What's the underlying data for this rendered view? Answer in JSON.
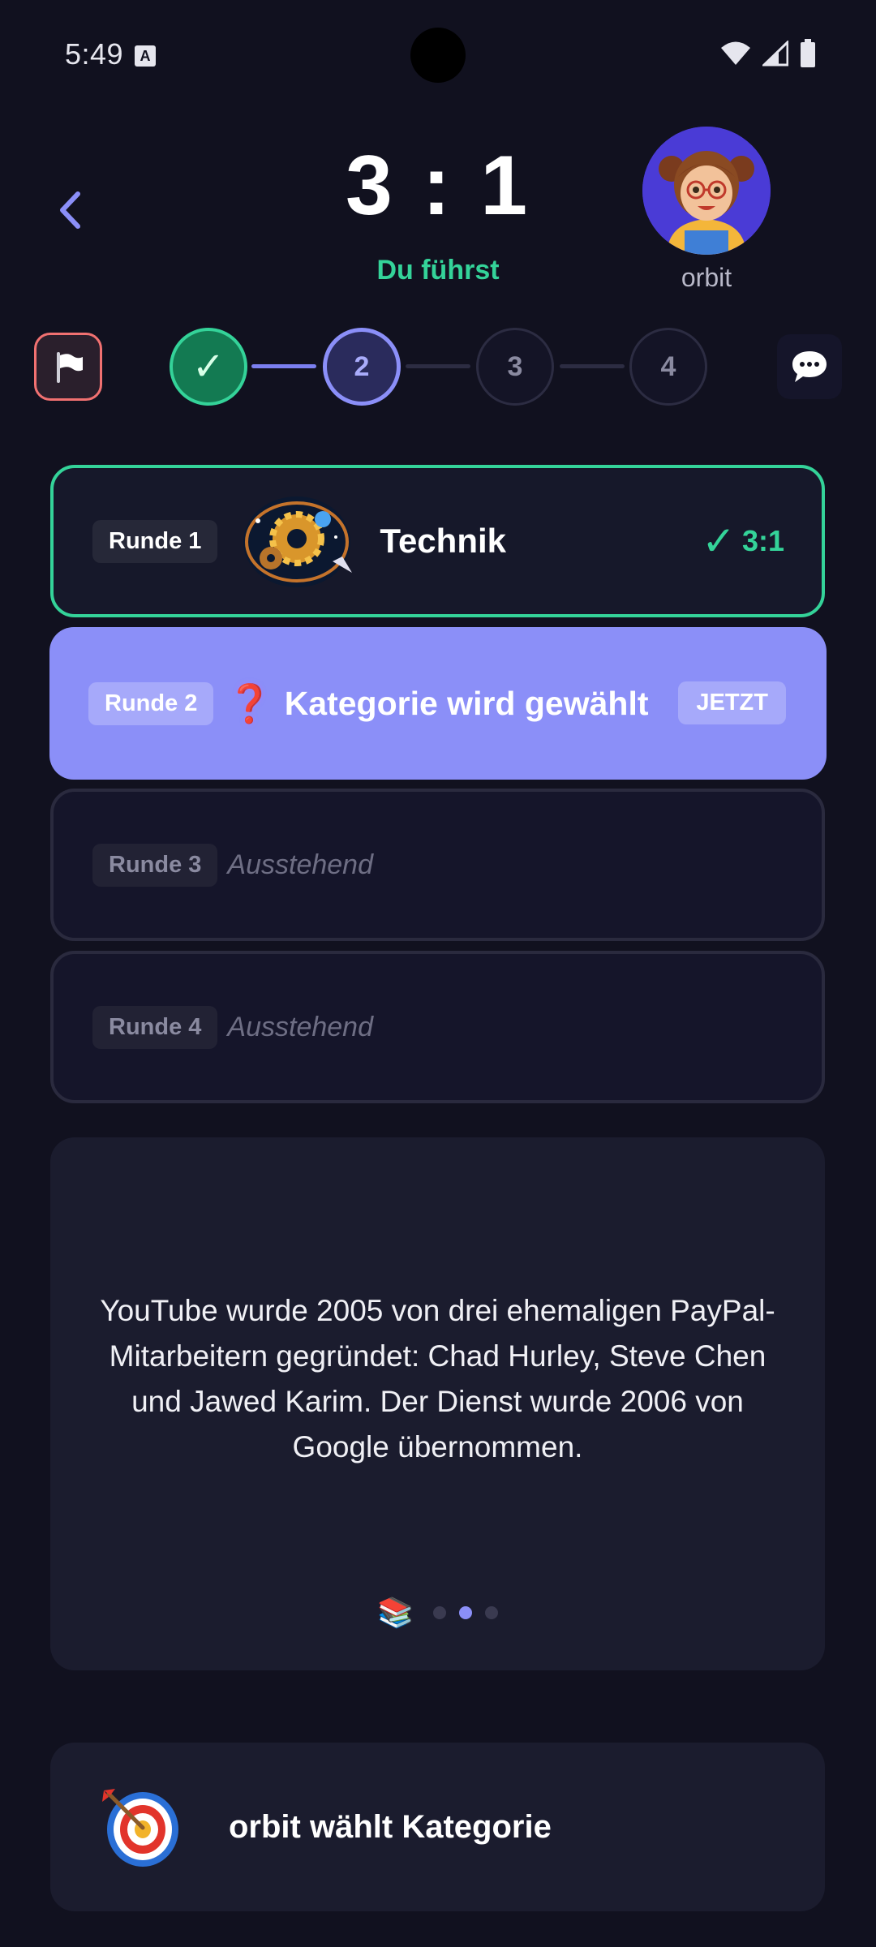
{
  "status_bar": {
    "time": "5:49",
    "notification_icon": "A",
    "icons": [
      "wifi-icon",
      "signal-icon",
      "battery-icon"
    ]
  },
  "header": {
    "back_icon": "chevron-left-icon",
    "score": "3 : 1",
    "lead_text": "Du führst",
    "opponent_name": "orbit",
    "opponent_avatar": "girl-with-glasses-avatar"
  },
  "progress": {
    "flag_icon": "white-flag-icon",
    "steps": [
      {
        "label": "✓",
        "state": "done"
      },
      {
        "label": "2",
        "state": "current"
      },
      {
        "label": "3",
        "state": "pending"
      },
      {
        "label": "4",
        "state": "pending"
      }
    ],
    "chat_icon": "speech-bubble-icon"
  },
  "rounds": [
    {
      "badge": "Runde 1",
      "category": "Technik",
      "category_icon": "gear-galaxy-icon",
      "result_check": "✓",
      "result": "3:1",
      "state": "done"
    },
    {
      "badge": "Runde 2",
      "icon": "❓",
      "text": "Kategorie wird gewählt",
      "now_label": "JETZT",
      "state": "current"
    },
    {
      "badge": "Runde 3",
      "text": "Ausstehend",
      "state": "pending"
    },
    {
      "badge": "Runde 4",
      "text": "Ausstehend",
      "state": "pending"
    }
  ],
  "fact": {
    "text": "YouTube wurde 2005 von drei ehemaligen PayPal-Mitarbeitern gegründet: Chad Hurley, Steve Chen und Jawed Karim. Der Dienst wurde 2006 von Google übernommen.",
    "icon": "📚",
    "pages": 3,
    "active_page": 2
  },
  "bottom": {
    "icon": "target-dart-icon",
    "text": "orbit wählt Kategorie"
  },
  "colors": {
    "background": "#11111f",
    "accent": "#8b8ff8",
    "success": "#34d399",
    "danger": "#f17171"
  }
}
